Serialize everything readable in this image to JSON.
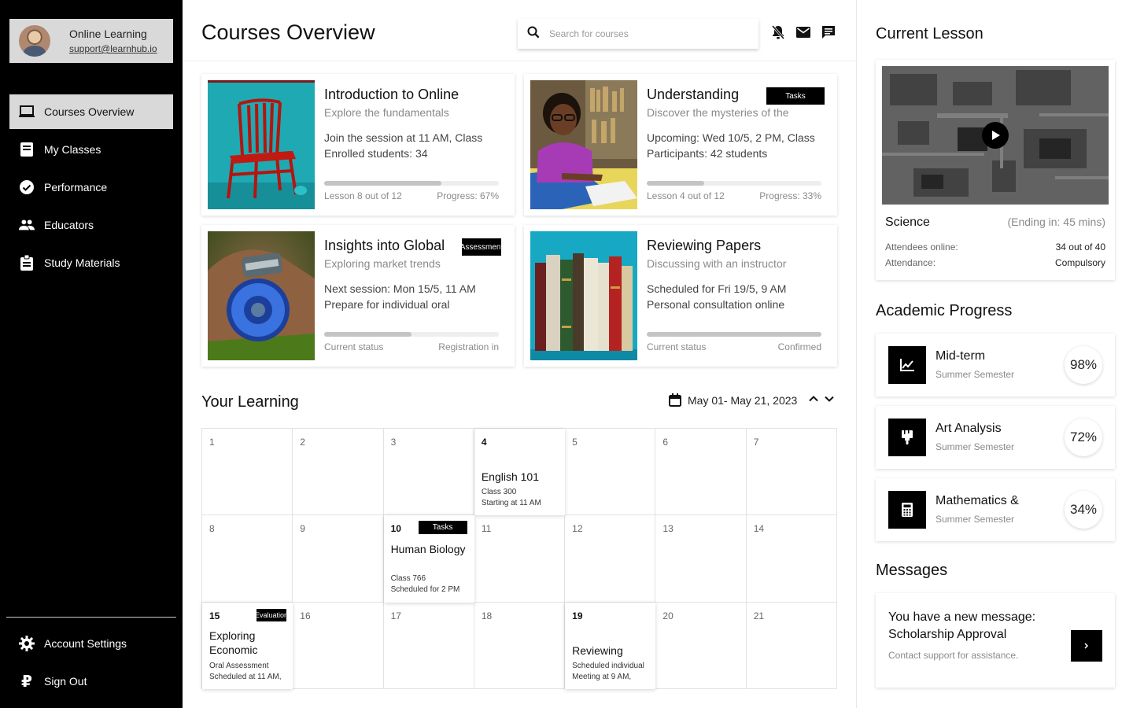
{
  "profile": {
    "name": "Online Learning",
    "email": "support@learnhub.io"
  },
  "nav": {
    "items": [
      {
        "label": "Courses Overview",
        "icon": "laptop-icon"
      },
      {
        "label": "My Classes",
        "icon": "book-icon"
      },
      {
        "label": "Performance",
        "icon": "check-circle-icon"
      },
      {
        "label": "Educators",
        "icon": "people-icon"
      },
      {
        "label": "Study Materials",
        "icon": "clipboard-icon"
      }
    ],
    "bottom": [
      {
        "label": "Account Settings",
        "icon": "gear-icon"
      },
      {
        "label": "Sign Out",
        "icon": "ruble-icon"
      }
    ]
  },
  "header": {
    "title": "Courses Overview",
    "search_placeholder": "Search for courses"
  },
  "courses": [
    {
      "title": "Introduction to Online",
      "subtitle": "Explore the fundamentals",
      "line1": "Join the session at 11 AM, Class",
      "line2": "Enrolled students: 34",
      "progress": 0.67,
      "foot_left": "Lesson 8 out of 12",
      "foot_right": "Progress: 67%",
      "tag": ""
    },
    {
      "title": "Understanding",
      "subtitle": "Discover the mysteries of the",
      "line1": "Upcoming: Wed 10/5, 2 PM, Class",
      "line2": "Participants: 42 students",
      "progress": 0.33,
      "foot_left": "Lesson 4 out of 12",
      "foot_right": "Progress: 33%",
      "tag": "Tasks"
    },
    {
      "title": "Insights into Global",
      "subtitle": "Exploring market trends",
      "line1": "Next session: Mon 15/5, 11 AM",
      "line2": "Prepare for individual oral",
      "progress": 0.5,
      "foot_left": "Current status",
      "foot_right": "Registration in",
      "tag": "Assessment"
    },
    {
      "title": "Reviewing Papers",
      "subtitle": "Discussing with an instructor",
      "line1": "Scheduled for Fri 19/5, 9 AM",
      "line2": "Personal consultation online",
      "progress": 1.0,
      "foot_left": "Current status",
      "foot_right": "Confirmed",
      "tag": ""
    }
  ],
  "learning": {
    "title": "Your Learning",
    "date_range": "May 01- May 21, 2023"
  },
  "calendar": {
    "days": [
      "1",
      "2",
      "3",
      "4",
      "5",
      "6",
      "7",
      "8",
      "9",
      "10",
      "11",
      "12",
      "13",
      "14",
      "15",
      "16",
      "17",
      "18",
      "19",
      "20",
      "21"
    ],
    "events": {
      "4": {
        "title": "English 101",
        "sub1": "Class 300",
        "sub2": "Starting at 11 AM",
        "tag": ""
      },
      "10": {
        "title": "Human Biology",
        "sub1": "Class 766",
        "sub2": "Scheduled for 2 PM",
        "tag": "Tasks"
      },
      "15": {
        "title": "Exploring Economic",
        "sub1": "Oral Assessment",
        "sub2": "Scheduled at 11 AM,",
        "tag": "Evaluation"
      },
      "19": {
        "title": "Reviewing",
        "sub1": "Scheduled individual",
        "sub2": "Meeting at 9 AM,",
        "tag": ""
      }
    }
  },
  "lesson": {
    "heading": "Current Lesson",
    "subject": "Science",
    "ending": "(Ending in: 45 mins)",
    "attendees_label": "Attendees online:",
    "attendees_value": "34 out of 40",
    "attendance_label": "Attendance:",
    "attendance_value": "Compulsory"
  },
  "progress": {
    "heading": "Academic Progress",
    "items": [
      {
        "title": "Mid-term",
        "sub": "Summer Semester",
        "pct": "98%",
        "icon": "line-chart-icon"
      },
      {
        "title": "Art Analysis",
        "sub": "Summer Semester",
        "pct": "72%",
        "icon": "brush-icon"
      },
      {
        "title": "Mathematics &",
        "sub": "Summer Semester",
        "pct": "34%",
        "icon": "calculator-icon"
      }
    ]
  },
  "messages": {
    "heading": "Messages",
    "title_line1": "You have a new message:",
    "title_line2": "Scholarship Approval",
    "sub": "Contact support for assistance."
  },
  "colors": {
    "accent": "#000000",
    "active_nav": "#d9d9d9",
    "bar_fill": "#c4c4c4"
  }
}
